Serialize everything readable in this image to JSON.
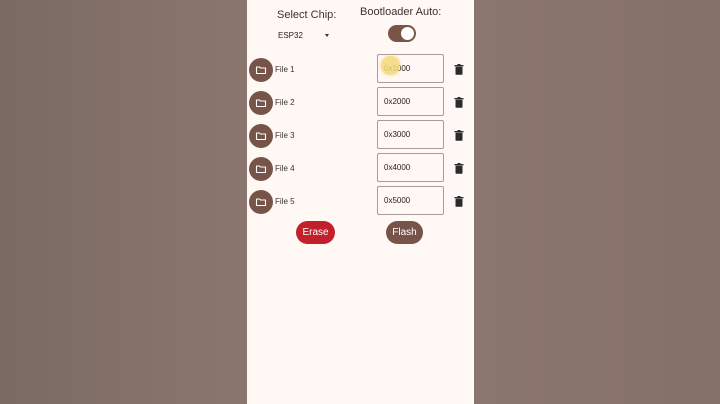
{
  "header": {
    "chip_label": "Select Chip:",
    "bootloader_label": "Bootloader Auto:"
  },
  "chip_select": {
    "value": "ESP32",
    "caret_icon": "dropdown-caret-icon"
  },
  "bootloader_toggle": {
    "on": true,
    "track_color": "#7b5448"
  },
  "files": [
    {
      "label": "File 1",
      "address": "0x1000"
    },
    {
      "label": "File 2",
      "address": "0x2000"
    },
    {
      "label": "File 3",
      "address": "0x3000"
    },
    {
      "label": "File 4",
      "address": "0x4000"
    },
    {
      "label": "File 5",
      "address": "0x5000"
    }
  ],
  "actions": {
    "erase_label": "Erase",
    "flash_label": "Flash"
  },
  "colors": {
    "accent": "#765449",
    "danger": "#c0212c",
    "background": "#fff8f4"
  },
  "icons": {
    "folder": "folder-icon",
    "delete": "trash-icon"
  }
}
